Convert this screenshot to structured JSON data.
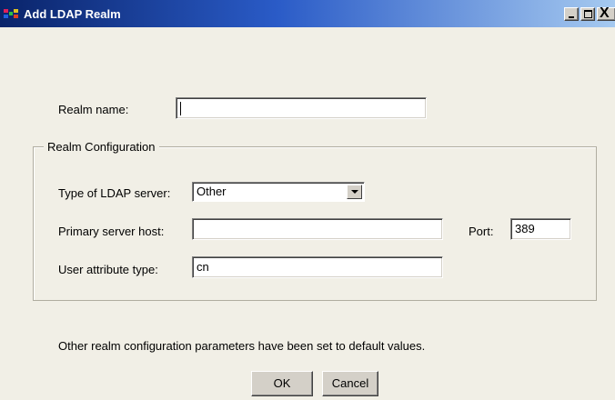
{
  "window": {
    "title": "Add LDAP Realm",
    "controls": {
      "minimize": "_",
      "maximize": "□",
      "close": "X"
    }
  },
  "form": {
    "realm_name_label": "Realm name:",
    "realm_name_value": "",
    "group_title": "Realm Configuration",
    "ldap_type_label": "Type of LDAP server:",
    "ldap_type_value": "Other",
    "primary_host_label": "Primary server host:",
    "primary_host_value": "",
    "port_label": "Port:",
    "port_value": "389",
    "user_attr_label": "User attribute type:",
    "user_attr_value": "cn",
    "note": "Other realm configuration parameters have been set to default values."
  },
  "buttons": {
    "ok": "OK",
    "cancel": "Cancel"
  },
  "colors": {
    "titlebar_start": "#0a246a",
    "titlebar_end": "#a6caf0",
    "window_bg": "#f1efe6"
  },
  "icons": [
    "app-icon",
    "minimize-icon",
    "maximize-icon",
    "close-icon",
    "dropdown-arrow-icon"
  ]
}
